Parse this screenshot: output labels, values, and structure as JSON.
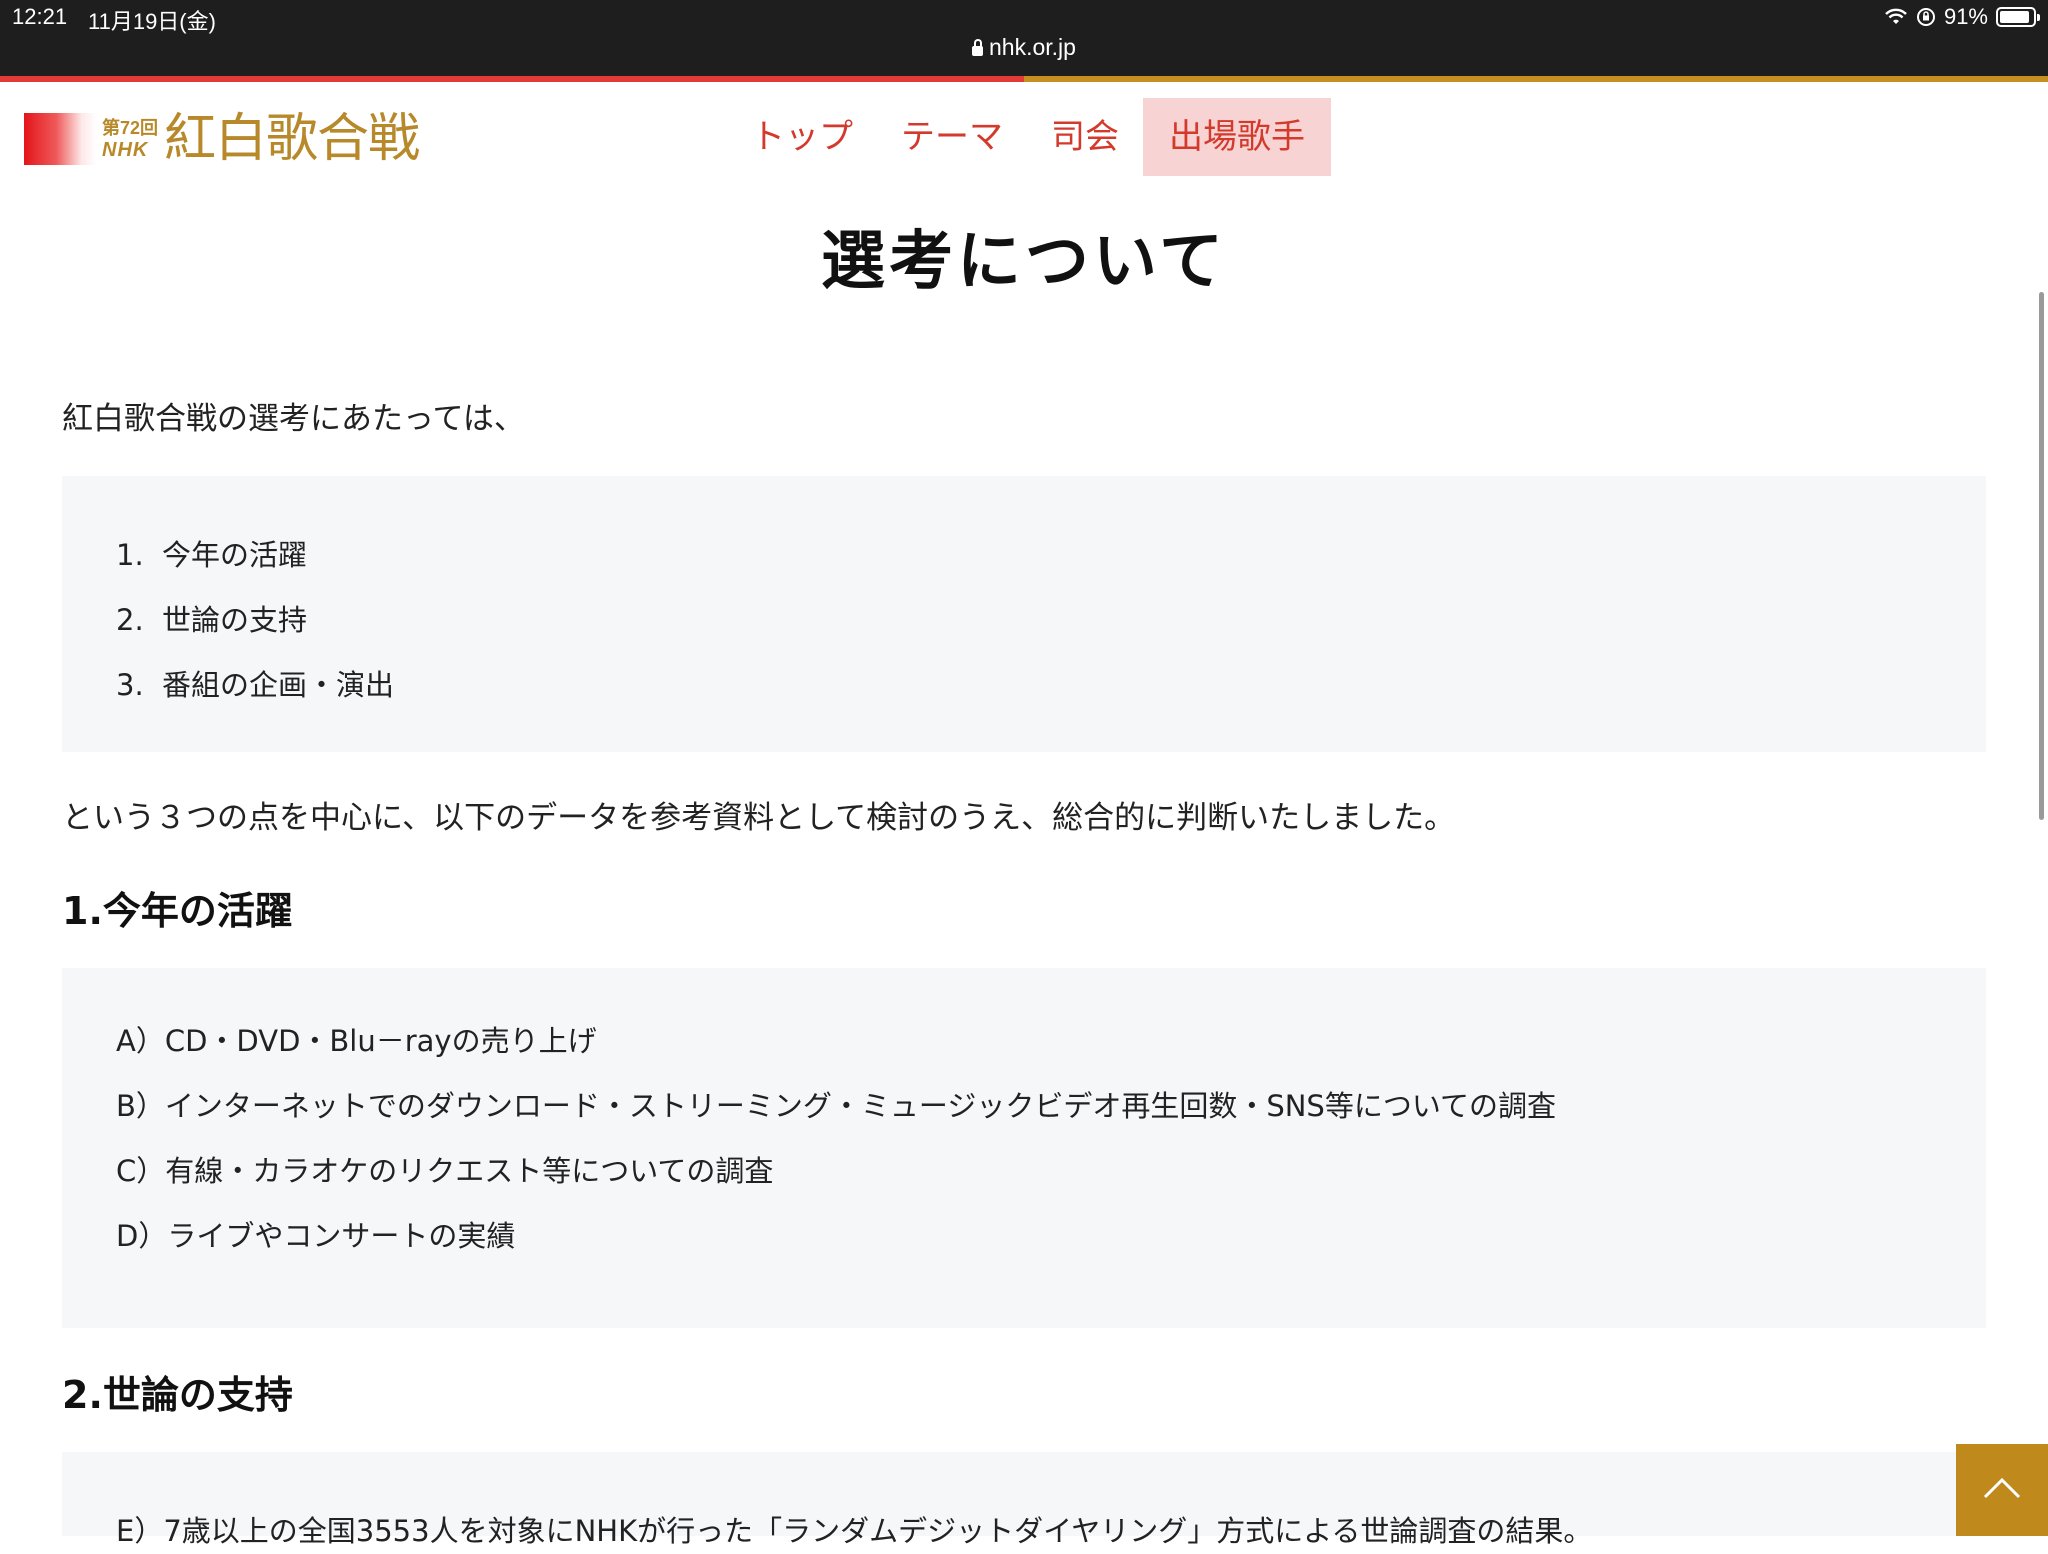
{
  "status_bar": {
    "time": "12:21",
    "date": "11月19日(金)",
    "url": "nhk.or.jp",
    "battery": "91%",
    "battery_level": 0.91
  },
  "header": {
    "logo": {
      "ordinal": "第72回",
      "network": "NHK",
      "title": "紅白歌合戦"
    },
    "nav": [
      {
        "label": "トップ",
        "active": false
      },
      {
        "label": "テーマ",
        "active": false
      },
      {
        "label": "司会",
        "active": false
      },
      {
        "label": "出場歌手",
        "active": true
      }
    ]
  },
  "content": {
    "title": "選考について",
    "intro": "紅白歌合戦の選考にあたっては、",
    "criteria": [
      {
        "num": "1.",
        "text": "今年の活躍"
      },
      {
        "num": "2.",
        "text": "世論の支持"
      },
      {
        "num": "3.",
        "text": "番組の企画・演出"
      }
    ],
    "summary": "という３つの点を中心に、以下のデータを参考資料として検討のうえ、総合的に判断いたしました。",
    "section1": {
      "heading": "1.今年の活躍",
      "items": [
        "A）CD・DVD・Blu－rayの売り上げ",
        "B）インターネットでのダウンロード・ストリーミング・ミュージックビデオ再生回数・SNS等についての調査",
        "C）有線・カラオケのリクエスト等についての調査",
        "D）ライブやコンサートの実績"
      ]
    },
    "section2": {
      "heading": "2.世論の支持",
      "items": [
        "E）7歳以上の全国3553人を対象にNHKが行った「ランダムデジットダイヤリング」方式による世論調査の結果。"
      ]
    }
  },
  "colors": {
    "accent_red": "#e23a36",
    "accent_gold": "#c59020",
    "nav_text": "#d33a2c",
    "nav_active_bg": "#f7d3d3",
    "box_bg": "#f6f7f9",
    "back_to_top": "#c0891c"
  },
  "icons": {
    "lock": "lock-icon",
    "wifi": "wifi-icon",
    "orientation_lock": "orientation-lock-icon",
    "battery": "battery-icon",
    "back_to_top": "chevron-up-icon"
  }
}
